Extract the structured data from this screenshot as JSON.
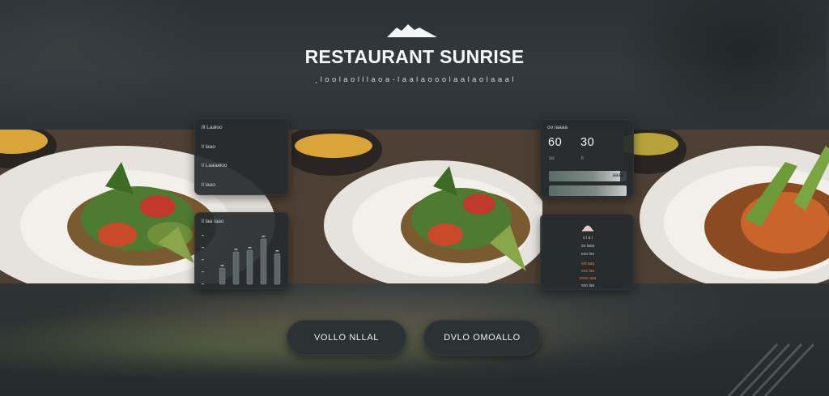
{
  "header": {
    "title": "RESTAURANT SUNRISE",
    "tagline": "¸ l o o  l a o  l l l  a o a - l a a l a o o  o l a a l a o  l a a a l"
  },
  "menu_panel": {
    "items": [
      "lll Laaloo",
      "ll laao",
      "ll Laaaaloo",
      "ll laao"
    ]
  },
  "chart_panel": {
    "title": "ll laa laao",
    "chart_data": {
      "type": "bar",
      "categories": [
        "",
        "",
        "",
        "",
        ""
      ],
      "values": [
        2,
        4,
        4.2,
        5.6,
        3.8
      ],
      "ylim": [
        0,
        6
      ]
    }
  },
  "stats_panel": {
    "title": "oo laaaa",
    "stat1": "60",
    "stat2": "30",
    "stat1_sub": "oo",
    "stat2_sub": "ll",
    "bar1_label": "aaaa",
    "bar1_level": 0.92,
    "bar2_label": "",
    "bar2_level": 1.0
  },
  "review_panel": {
    "rows": [
      "o l a l",
      "oo laoa",
      "ooo loo",
      "ool aaa",
      "ooo laa",
      "oooo aaa",
      "ooo laa"
    ]
  },
  "buttons": {
    "view_menu": "VOLLO  NLLAL",
    "book_table": "DVLO OMOALLO"
  },
  "colors": {
    "accent_orange": "#e07a3c",
    "panel_bg": "#262b2e",
    "button_bg": "#2c3134"
  },
  "icons": {
    "logo": "mountain-logo-icon",
    "review": "cloche-icon"
  }
}
